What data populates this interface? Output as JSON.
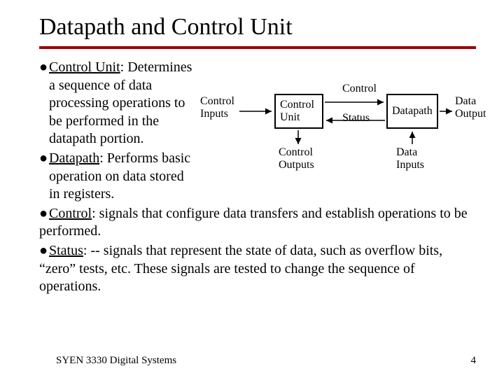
{
  "title": "Datapath and Control Unit",
  "bullets": [
    {
      "term": "Control Unit",
      "rest": ": Determines a sequence of data processing operations to be performed in the datapath portion.",
      "wrap": true
    },
    {
      "term": "Datapath",
      "rest": ": Performs basic operation on data stored in registers.",
      "wrap": true
    },
    {
      "term": "Control",
      "rest": ": signals that configure data transfers and establish operations to be performed.",
      "wrap": false
    },
    {
      "term": "Status",
      "rest": ": -- signals that represent the state of data, such as overflow bits, “zero” tests, etc. These signals are tested to change the sequence of operations.",
      "wrap": false
    }
  ],
  "diagram": {
    "box_cu1": "Control",
    "box_cu2": "Unit",
    "box_dp": "Datapath",
    "lbl_ci1": "Control",
    "lbl_ci2": "Inputs",
    "lbl_ctrl": "Control",
    "lbl_status": "Status",
    "lbl_co1": "Control",
    "lbl_co2": "Outputs",
    "lbl_di1": "Data",
    "lbl_di2": "Inputs",
    "lbl_do1": "Data",
    "lbl_do2": "Output"
  },
  "footer_left": "SYEN 3330 Digital Systems",
  "footer_right": "4"
}
